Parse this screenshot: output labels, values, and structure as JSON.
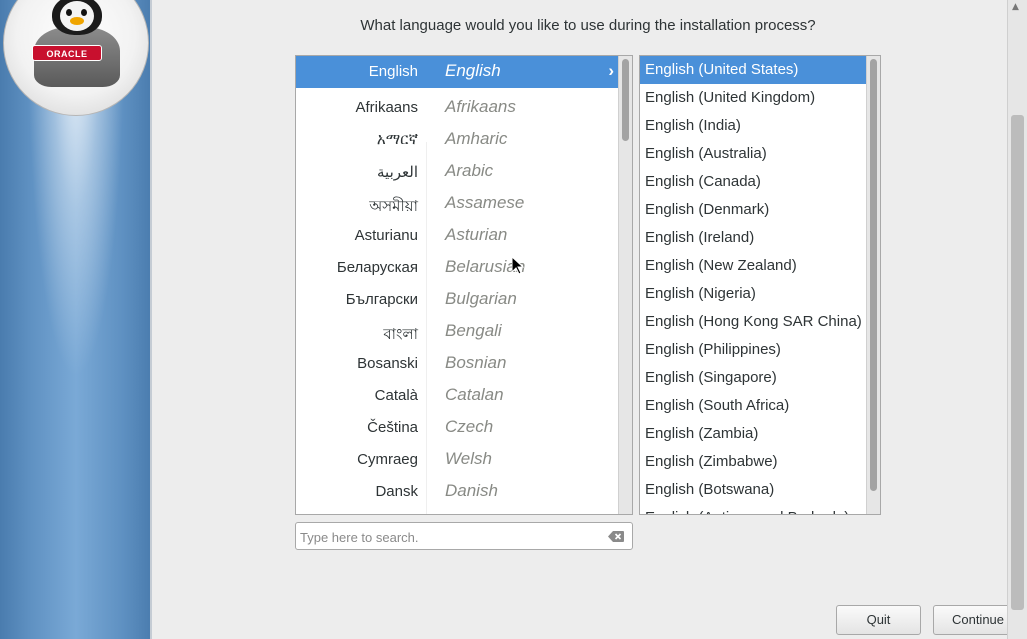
{
  "sidebar": {
    "logo_text": "ORACLE",
    "logo_name": "oracle-linux-penguin-logo"
  },
  "header": {
    "question": "What language would you like to use during the installation process?"
  },
  "languages": [
    {
      "native": "English",
      "english": "English",
      "selected": true
    },
    {
      "native": "Afrikaans",
      "english": "Afrikaans"
    },
    {
      "native": "አማርኛ",
      "english": "Amharic"
    },
    {
      "native": "العربية",
      "english": "Arabic"
    },
    {
      "native": "অসমীয়া",
      "english": "Assamese"
    },
    {
      "native": "Asturianu",
      "english": "Asturian"
    },
    {
      "native": "Беларуская",
      "english": "Belarusian"
    },
    {
      "native": "Български",
      "english": "Bulgarian"
    },
    {
      "native": "বাংলা",
      "english": "Bengali"
    },
    {
      "native": "Bosanski",
      "english": "Bosnian"
    },
    {
      "native": "Català",
      "english": "Catalan"
    },
    {
      "native": "Čeština",
      "english": "Czech"
    },
    {
      "native": "Cymraeg",
      "english": "Welsh"
    },
    {
      "native": "Dansk",
      "english": "Danish"
    }
  ],
  "locales": [
    "English (United States)",
    "English (United Kingdom)",
    "English (India)",
    "English (Australia)",
    "English (Canada)",
    "English (Denmark)",
    "English (Ireland)",
    "English (New Zealand)",
    "English (Nigeria)",
    "English (Hong Kong SAR China)",
    "English (Philippines)",
    "English (Singapore)",
    "English (South Africa)",
    "English (Zambia)",
    "English (Zimbabwe)",
    "English (Botswana)",
    "English (Antigua and Barbuda)"
  ],
  "locale_selected_index": 0,
  "search": {
    "placeholder": "Type here to search."
  },
  "buttons": {
    "quit": "Quit",
    "continue": "Continue"
  },
  "colors": {
    "selection": "#4a90d9",
    "sidebar": "#5f91c2"
  }
}
